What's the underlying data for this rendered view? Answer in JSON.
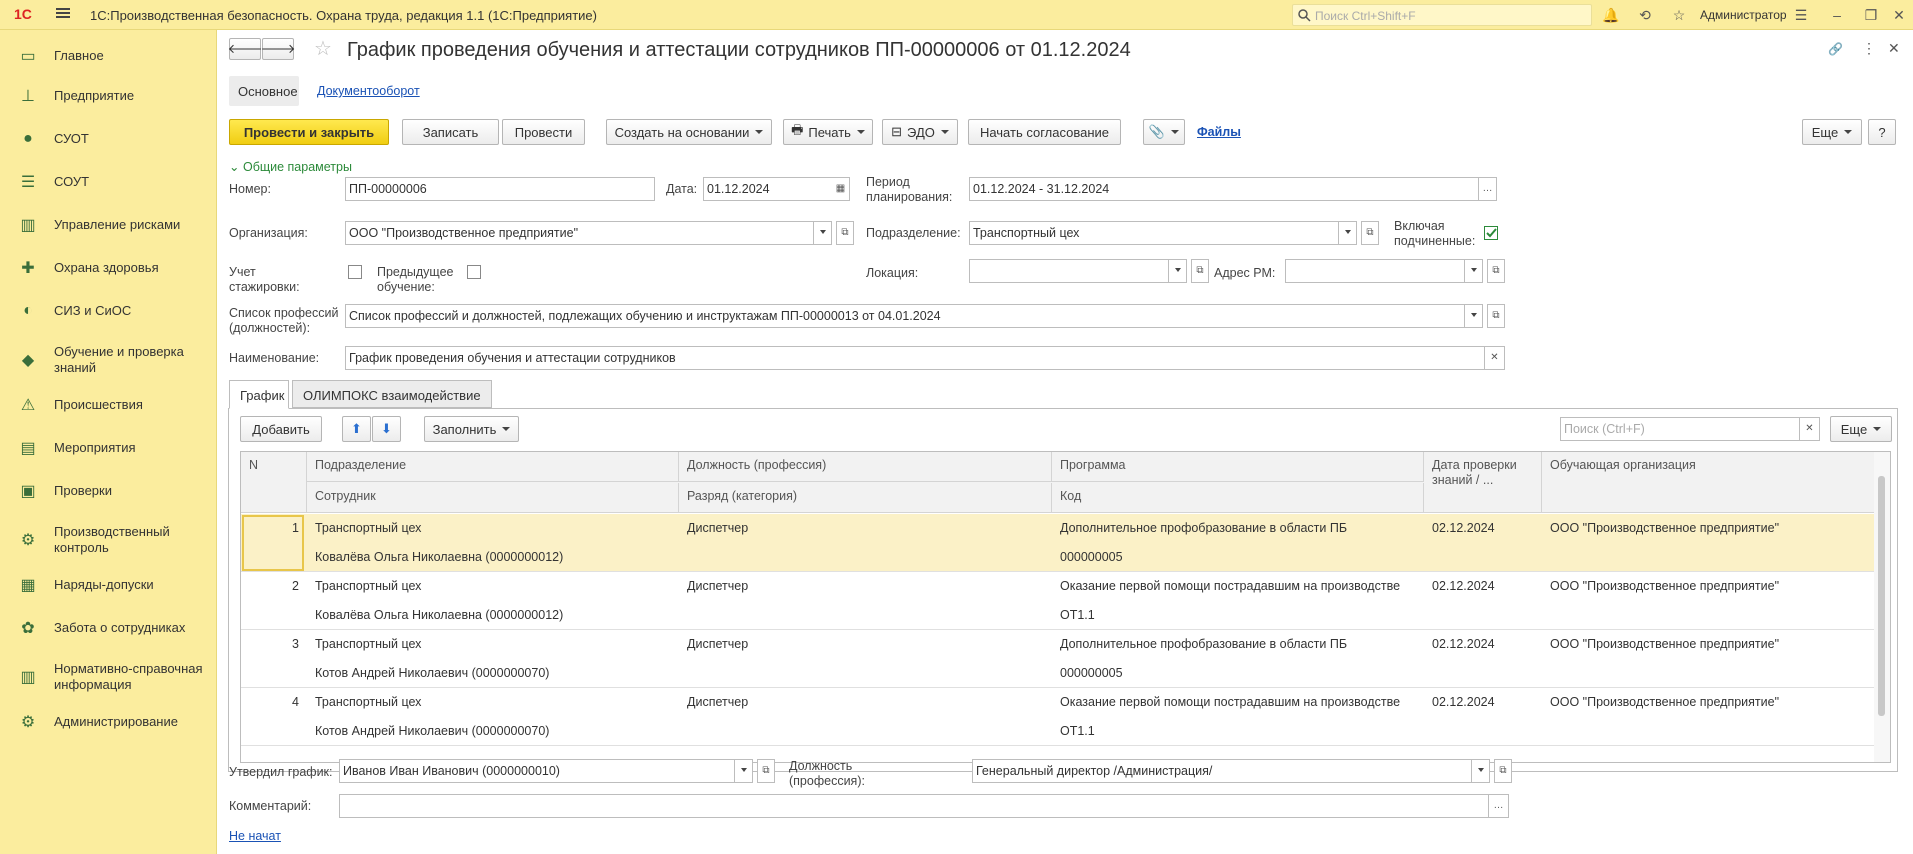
{
  "app": {
    "logo": "1С",
    "title": "1С:Производственная безопасность. Охрана труда, редакция 1.1  (1С:Предприятие)",
    "search_placeholder": "Поиск Ctrl+Shift+F",
    "user": "Администратор"
  },
  "sidebar": {
    "items": [
      {
        "label": "Главное",
        "icon": "desktop-icon"
      },
      {
        "label": "Предприятие",
        "icon": "org-structure-icon"
      },
      {
        "label": "СУОТ",
        "icon": "worker-icon"
      },
      {
        "label": "СОУТ",
        "icon": "checklist-icon"
      },
      {
        "label": "Управление рисками",
        "icon": "risk-chart-icon"
      },
      {
        "label": "Охрана здоровья",
        "icon": "medical-cross-icon"
      },
      {
        "label": "СИЗ и СиОС",
        "icon": "ppe-icon"
      },
      {
        "label": "Обучение и проверка знаний",
        "icon": "training-icon"
      },
      {
        "label": "Происшествия",
        "icon": "warning-icon"
      },
      {
        "label": "Мероприятия",
        "icon": "tasks-icon"
      },
      {
        "label": "Проверки",
        "icon": "audit-icon"
      },
      {
        "label": "Производственный контроль",
        "icon": "control-icon"
      },
      {
        "label": "Наряды-допуски",
        "icon": "permit-icon"
      },
      {
        "label": "Забота о сотрудниках",
        "icon": "care-icon"
      },
      {
        "label": "Нормативно-справочная информация",
        "icon": "library-icon"
      },
      {
        "label": "Администрирование",
        "icon": "admin-icon"
      }
    ]
  },
  "document": {
    "title": "График проведения обучения и аттестации сотрудников ПП-00000006 от 01.12.2024",
    "subtabs": {
      "main": "Основное",
      "workflow": "Документооборот"
    },
    "toolbar": {
      "post_close": "Провести и закрыть",
      "save": "Записать",
      "post": "Провести",
      "create_based": "Создать на основании",
      "print": "Печать",
      "edo": "ЭДО",
      "approval": "Начать согласование",
      "files": "Файлы",
      "more": "Еще",
      "help": "?"
    },
    "group_title": "Общие параметры",
    "fields": {
      "number_label": "Номер:",
      "number": "ПП-00000006",
      "date_label": "Дата:",
      "date": "01.12.2024",
      "period_label": "Период планирования:",
      "period": "01.12.2024 - 31.12.2024",
      "org_label": "Организация:",
      "org": "ООО \"Производственное предприятие\"",
      "dept_label": "Подразделение:",
      "dept": "Транспортный цех",
      "include_sub_label": "Включая подчиненные:",
      "intern_label": "Учет стажировки:",
      "prev_training_label": "Предыдущее обучение:",
      "location_label": "Локация:",
      "workplace_label": "Адрес РМ:",
      "prof_list_label": "Список профессий (должностей):",
      "prof_list": "Список профессий и должностей, подлежащих обучению и инструктажам ПП-00000013 от 04.01.2024",
      "name_label": "Наименование:",
      "name": "График проведения обучения и аттестации сотрудников"
    },
    "tabs": {
      "schedule": "График",
      "olympox": "ОЛИМПОКС взаимодействие"
    },
    "table_toolbar": {
      "add": "Добавить",
      "fill": "Заполнить",
      "search_placeholder": "Поиск (Ctrl+F)",
      "more": "Еще"
    },
    "table": {
      "headers": {
        "n": "N",
        "dept": "Подразделение",
        "employee": "Сотрудник",
        "position": "Должность (профессия)",
        "grade": "Разряд (категория)",
        "program": "Программа",
        "code": "Код",
        "check_date": "Дата проверки знаний / ...",
        "provider": "Обучающая организация"
      },
      "rows": [
        {
          "n": "1",
          "dept": "Транспортный цех",
          "employee": "Ковалёва Ольга Николаевна (0000000012)",
          "position": "Диспетчер",
          "grade": "",
          "program": "Дополнительное профобразование в области ПБ",
          "code": "000000005",
          "date": "02.12.2024",
          "provider": "ООО \"Производственное предприятие\""
        },
        {
          "n": "2",
          "dept": "Транспортный цех",
          "employee": "Ковалёва Ольга Николаевна (0000000012)",
          "position": "Диспетчер",
          "grade": "",
          "program": "Оказание первой помощи пострадавшим на производстве",
          "code": "ОТ1.1",
          "date": "02.12.2024",
          "provider": "ООО \"Производственное предприятие\""
        },
        {
          "n": "3",
          "dept": "Транспортный цех",
          "employee": "Котов Андрей Николаевич (0000000070)",
          "position": "Диспетчер",
          "grade": "",
          "program": "Дополнительное профобразование в области ПБ",
          "code": "000000005",
          "date": "02.12.2024",
          "provider": "ООО \"Производственное предприятие\""
        },
        {
          "n": "4",
          "dept": "Транспортный цех",
          "employee": "Котов Андрей Николаевич (0000000070)",
          "position": "Диспетчер",
          "grade": "",
          "program": "Оказание первой помощи пострадавшим на производстве",
          "code": "ОТ1.1",
          "date": "02.12.2024",
          "provider": "ООО \"Производственное предприятие\""
        }
      ]
    },
    "footer": {
      "approved_label": "Утвердил график:",
      "approved": "Иванов Иван Иванович (0000000010)",
      "position_label": "Должность (профессия):",
      "position": "Генеральный директор /Администрация/",
      "comment_label": "Комментарий:",
      "comment": "",
      "status_link": "Не начат"
    }
  }
}
